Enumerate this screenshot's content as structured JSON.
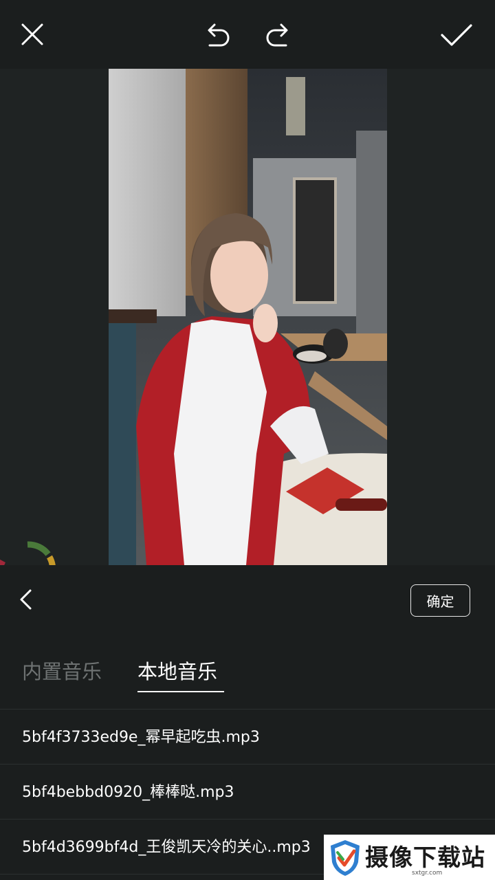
{
  "toolbar": {
    "close_icon": "close-icon",
    "undo_icon": "undo-icon",
    "redo_icon": "redo-icon",
    "done_icon": "checkmark-icon"
  },
  "panel": {
    "confirm_label": "确定",
    "tabs": [
      {
        "label": "内置音乐",
        "selected": false
      },
      {
        "label": "本地音乐",
        "selected": true
      }
    ],
    "files": [
      {
        "name": "5bf4f3733ed9e_幂早起吃虫.mp3"
      },
      {
        "name": "5bf4bebbd0920_棒棒哒.mp3"
      },
      {
        "name": "5bf4d3699bf4d_王俊凯天冷的关心..mp3"
      }
    ]
  },
  "watermark": {
    "title": "摄像下载站",
    "domain": "sxtgr.com"
  },
  "colors": {
    "background": "#1b1e1e",
    "preview_bg": "#1f2323",
    "inactive_tab": "#6e7272",
    "divider": "#2c3030"
  }
}
